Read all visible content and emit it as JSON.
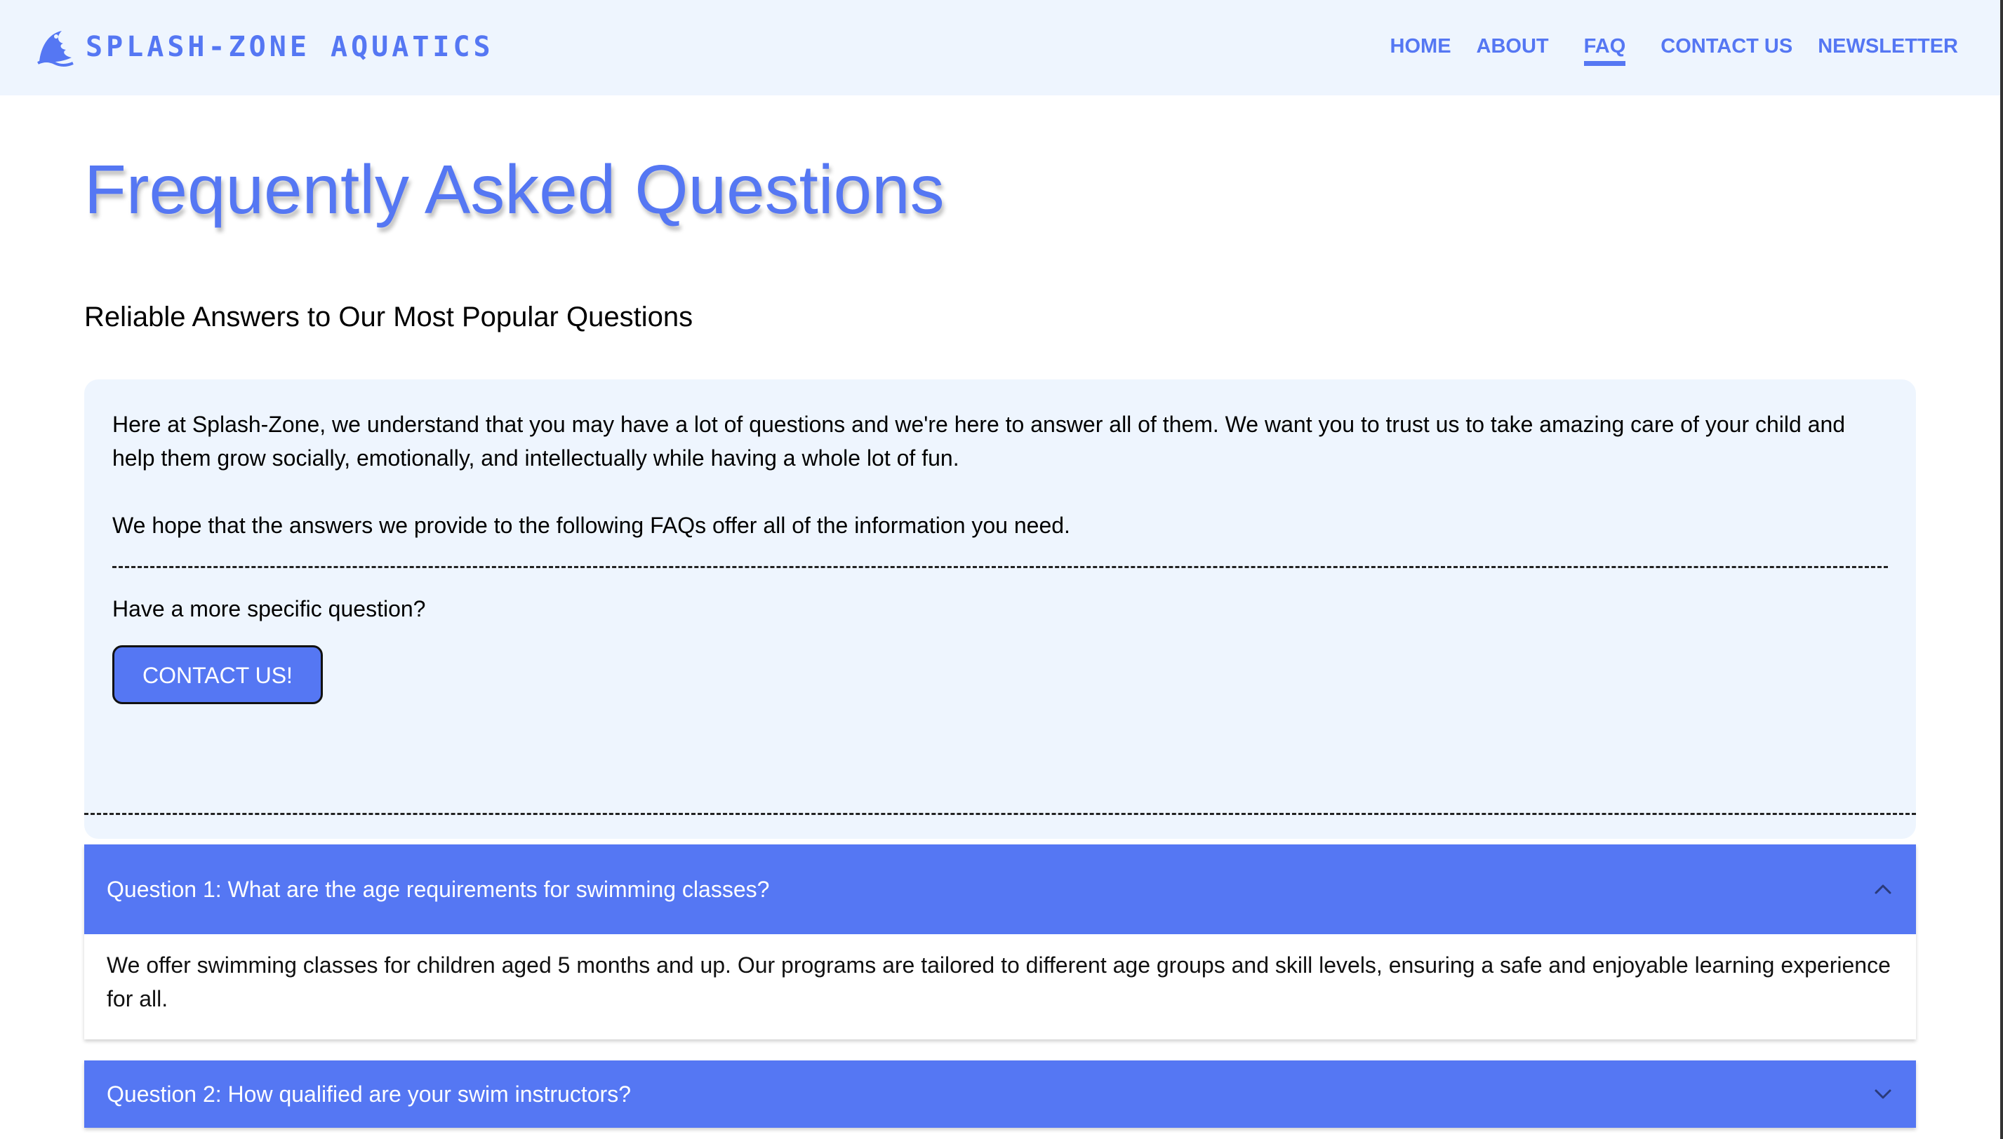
{
  "brand": {
    "name": "SPLASH-ZONE AQUATICS",
    "icon": "swimmer-wave-icon"
  },
  "nav": {
    "items": [
      {
        "label": "HOME"
      },
      {
        "label": "ABOUT"
      },
      {
        "label": "FAQ",
        "active": true
      },
      {
        "label": "CONTACT US"
      },
      {
        "label": "NEWSLETTER"
      }
    ]
  },
  "page": {
    "title": "Frequently Asked Questions",
    "subtitle": "Reliable Answers to Our Most Popular Questions"
  },
  "intro": {
    "paragraph1": "Here at Splash-Zone, we understand that you may have a lot of questions and we're here to answer all of them. We want you to trust us to take amazing care of your child and help them grow socially, emotionally, and intellectually while having a whole lot of fun.",
    "paragraph2": "We hope that the answers we provide to the following FAQs offer all of the information you need.",
    "question_prompt": "Have a more specific question?",
    "contact_button": "CONTACT US!"
  },
  "faq": [
    {
      "question": "Question 1: What are the age requirements for swimming classes?",
      "answer": "We offer swimming classes for children aged 5 months and up. Our programs are tailored to different age groups and skill levels, ensuring a safe and enjoyable learning experience for all.",
      "expanded": true,
      "chevron": "chevron-up-icon"
    },
    {
      "question": "Question 2: How qualified are your swim instructors?",
      "answer": "",
      "expanded": false,
      "chevron": "chevron-down-icon"
    }
  ],
  "colors": {
    "accent": "#5577f3",
    "header_bg": "#eef5fe",
    "card_bg": "#eef5fe"
  }
}
